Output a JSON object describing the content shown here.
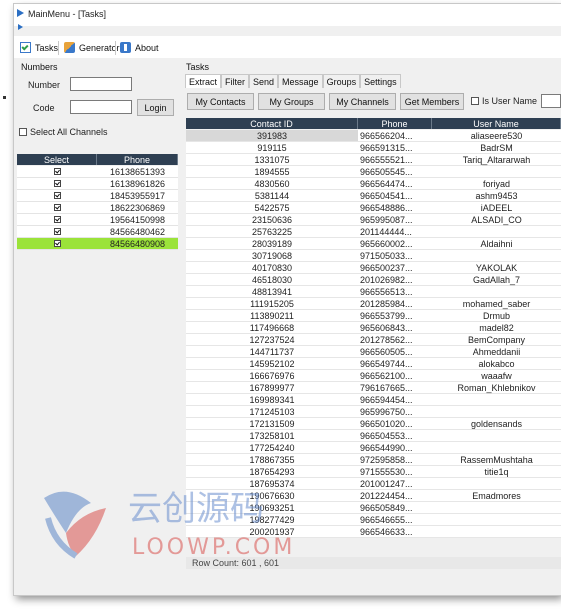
{
  "window": {
    "title": "MainMenu - [Tasks]"
  },
  "menubar": {
    "tasks": "Tasks",
    "generator": "Generator",
    "about": "About"
  },
  "numbers_panel": {
    "heading": "Numbers",
    "number_label": "Number",
    "code_label": "Code",
    "number_value": "",
    "code_value": "",
    "login_button": "Login",
    "select_all_label": "Select All Channels",
    "grid_headers": {
      "select": "Select",
      "phone": "Phone"
    },
    "rows": [
      {
        "checked": true,
        "phone": "16138651393"
      },
      {
        "checked": true,
        "phone": "16138961826"
      },
      {
        "checked": true,
        "phone": "18453955917"
      },
      {
        "checked": true,
        "phone": "18622306869"
      },
      {
        "checked": true,
        "phone": "19564150998"
      },
      {
        "checked": true,
        "phone": "84566480462"
      },
      {
        "checked": true,
        "phone": "84566480908",
        "selected": true
      }
    ]
  },
  "tasks_panel": {
    "heading": "Tasks",
    "tabs": [
      "Extract",
      "Filter",
      "Send",
      "Message",
      "Groups",
      "Settings"
    ],
    "buttons": {
      "my_contacts": "My Contacts",
      "my_groups": "My Groups",
      "my_channels": "My Channels",
      "get_members": "Get Members"
    },
    "is_user_name_label": "Is User Name",
    "grid_headers": {
      "contact_id": "Contact ID",
      "phone": "Phone",
      "user_name": "User Name"
    },
    "rows": [
      {
        "id": "391983",
        "phone": "966566204...",
        "user": "aliaseere530"
      },
      {
        "id": "919115",
        "phone": "966591315...",
        "user": "BadrSM"
      },
      {
        "id": "1331075",
        "phone": "966555521...",
        "user": "Tariq_Altararwah"
      },
      {
        "id": "1894555",
        "phone": "966505545...",
        "user": ""
      },
      {
        "id": "4830560",
        "phone": "966564474...",
        "user": "foriyad"
      },
      {
        "id": "5381144",
        "phone": "966504541...",
        "user": "ashm9453"
      },
      {
        "id": "5422575",
        "phone": "966548886...",
        "user": "iADEEL"
      },
      {
        "id": "23150636",
        "phone": "965995087...",
        "user": "ALSADI_CO"
      },
      {
        "id": "25763225",
        "phone": "201144444...",
        "user": ""
      },
      {
        "id": "28039189",
        "phone": "965660002...",
        "user": "Aldaihni"
      },
      {
        "id": "30719068",
        "phone": "971505033...",
        "user": ""
      },
      {
        "id": "40170830",
        "phone": "966500237...",
        "user": "YAKOLAK"
      },
      {
        "id": "46518030",
        "phone": "201026982...",
        "user": "GadAllah_7"
      },
      {
        "id": "48813941",
        "phone": "966556513...",
        "user": ""
      },
      {
        "id": "111915205",
        "phone": "201285984...",
        "user": "mohamed_saber"
      },
      {
        "id": "113890211",
        "phone": "966553799...",
        "user": "Drmub"
      },
      {
        "id": "117496668",
        "phone": "965606843...",
        "user": "madel82"
      },
      {
        "id": "127237524",
        "phone": "201278562...",
        "user": "BemCompany"
      },
      {
        "id": "144711737",
        "phone": "966560505...",
        "user": "Ahmeddanii"
      },
      {
        "id": "145952102",
        "phone": "966549744...",
        "user": "alokabco"
      },
      {
        "id": "166676976",
        "phone": "966562100...",
        "user": "waaafw"
      },
      {
        "id": "167899977",
        "phone": "796167665...",
        "user": "Roman_Khlebnikov"
      },
      {
        "id": "169989341",
        "phone": "966594454...",
        "user": ""
      },
      {
        "id": "171245103",
        "phone": "965996750...",
        "user": ""
      },
      {
        "id": "172131509",
        "phone": "966501020...",
        "user": "goldensands"
      },
      {
        "id": "173258101",
        "phone": "966504553...",
        "user": ""
      },
      {
        "id": "177254240",
        "phone": "966544990...",
        "user": ""
      },
      {
        "id": "178867355",
        "phone": "972595858...",
        "user": "RassemMushtaha"
      },
      {
        "id": "187654293",
        "phone": "971555530...",
        "user": "titie1q"
      },
      {
        "id": "187695374",
        "phone": "201001247...",
        "user": ""
      },
      {
        "id": "190676630",
        "phone": "201224454...",
        "user": "Emadmores"
      },
      {
        "id": "190693251",
        "phone": "966505849...",
        "user": ""
      },
      {
        "id": "198277429",
        "phone": "966546655...",
        "user": ""
      },
      {
        "id": "200201937",
        "phone": "966546633...",
        "user": ""
      }
    ],
    "row_count_text": "Row Count: 601 , 601"
  },
  "watermark": {
    "text": "云创源码",
    "sub": "LOOWP.COM"
  },
  "colors": {
    "grid_header": "#2e3f52",
    "selected_row": "#9be33a",
    "accent": "#2b6fc4"
  }
}
